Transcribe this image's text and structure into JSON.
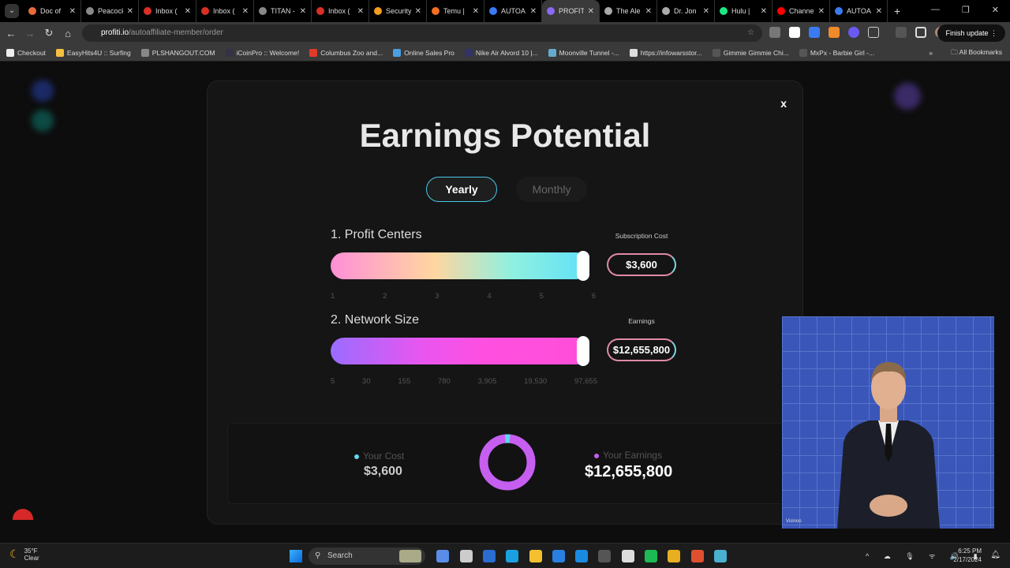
{
  "browser": {
    "tabs": [
      {
        "title": "Doc of",
        "color": "#e86a3a"
      },
      {
        "title": "Peacock",
        "color": "#888"
      },
      {
        "title": "Inbox (",
        "color": "#d93025"
      },
      {
        "title": "Inbox (",
        "color": "#d93025"
      },
      {
        "title": "TITAN -",
        "color": "#888"
      },
      {
        "title": "Inbox (",
        "color": "#d93025"
      },
      {
        "title": "Security",
        "color": "#f29d1e"
      },
      {
        "title": "Temu |",
        "color": "#f36f21"
      },
      {
        "title": "AUTOA",
        "color": "#3a7bf2"
      },
      {
        "title": "PROFITI",
        "color": "#8a6af2",
        "active": true
      },
      {
        "title": "The Ale",
        "color": "#aaa"
      },
      {
        "title": "Dr. Jon",
        "color": "#aaa"
      },
      {
        "title": "Hulu |",
        "color": "#1ce783"
      },
      {
        "title": "Channe",
        "color": "#f00"
      },
      {
        "title": "AUTOA",
        "color": "#3a7bf2"
      }
    ],
    "url_domain": "profiti.io",
    "url_path": "/autoaffiliate-member/order",
    "finish_update": "Finish update ⋮",
    "bookmarks": [
      "Checkout",
      "EasyHits4U :: Surfing",
      "PLSHANGOUT.COM",
      "iCoinPro :: Welcome!",
      "Columbus Zoo and...",
      "Online Sales Pro",
      "Nike Air Alvord 10 |...",
      "Moonville Tunnel -...",
      "https://infowarsstor...",
      "Gimmie Gimmie Chi...",
      "MxPx - Barbie Girl -..."
    ],
    "all_bookmarks": "All Bookmarks"
  },
  "modal": {
    "close": "x",
    "title": "Earnings Potential",
    "toggle": {
      "yearly": "Yearly",
      "monthly": "Monthly",
      "selected": "Yearly"
    },
    "profit_centers": {
      "label": "1. Profit Centers",
      "ticks": [
        "1",
        "2",
        "3",
        "4",
        "5",
        "6"
      ],
      "value": 6,
      "side_label": "Subscription Cost",
      "side_value": "$3,600"
    },
    "network_size": {
      "label": "2. Network Size",
      "ticks": [
        "5",
        "30",
        "155",
        "780",
        "3,905",
        "19,530",
        "97,655"
      ],
      "value": "97,655",
      "side_label": "Earnings",
      "side_value": "$12,655,800"
    },
    "summary": {
      "cost_label": "Your Cost",
      "cost_value": "$3,600",
      "earnings_label": "Your Earnings",
      "earnings_value": "$12,655,800",
      "cost_color": "#5fd6f0",
      "earnings_color": "#c65ff0"
    }
  },
  "video_overlay": {
    "watermark": "Visinoo"
  },
  "taskbar": {
    "temp": "35°F",
    "condition": "Clear",
    "search": "Search",
    "time": "6:25 PM",
    "date": "2/17/2024"
  }
}
